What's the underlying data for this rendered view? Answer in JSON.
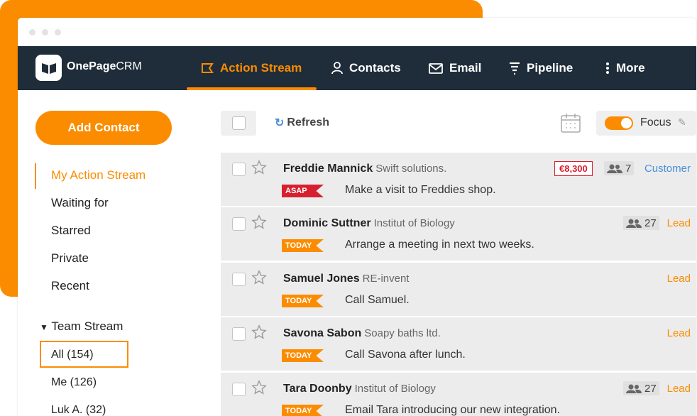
{
  "brand": {
    "logo_bold": "OnePage",
    "logo_light": "CRM",
    "accent": "#fb8c00",
    "navbar_bg": "#1f2d3a"
  },
  "nav": [
    {
      "label": "Action Stream",
      "icon": "action-stream-icon",
      "active": true
    },
    {
      "label": "Contacts",
      "icon": "contacts-icon"
    },
    {
      "label": "Email",
      "icon": "email-icon"
    },
    {
      "label": "Pipeline",
      "icon": "pipeline-icon"
    },
    {
      "label": "More",
      "icon": "more-vertical-icon"
    }
  ],
  "sidebar": {
    "add_contact": "Add Contact",
    "items": [
      "My Action Stream",
      "Waiting for",
      "Starred",
      "Private",
      "Recent"
    ],
    "team_stream": {
      "title": "Team Stream",
      "items": [
        "All (154)",
        "Me (126)",
        "Luk A. (32)"
      ]
    }
  },
  "toolbar": {
    "refresh": "Refresh",
    "focus": "Focus",
    "focus_on": true
  },
  "rows": [
    {
      "name": "Freddie Mannick",
      "company": "Swift solutions.",
      "tag": "ASAP",
      "action": "Make a visit to Freddies shop.",
      "amount": "€8,300",
      "people": "7",
      "status": "Customer"
    },
    {
      "name": "Dominic Suttner",
      "company": "Institut of Biology",
      "tag": "TODAY",
      "action": "Arrange a meeting in next two weeks.",
      "people": "27",
      "status": "Lead"
    },
    {
      "name": "Samuel Jones",
      "company": "RE-invent",
      "tag": "TODAY",
      "action": "Call Samuel.",
      "status": "Lead"
    },
    {
      "name": "Savona Sabon",
      "company": "Soapy baths ltd.",
      "tag": "TODAY",
      "action": "Call Savona after lunch.",
      "status": "Lead"
    },
    {
      "name": "Tara Doonby",
      "company": "Institut of Biology",
      "tag": "TODAY",
      "action": "Email Tara introducing our new integration.",
      "people": "27",
      "status": "Lead"
    }
  ]
}
